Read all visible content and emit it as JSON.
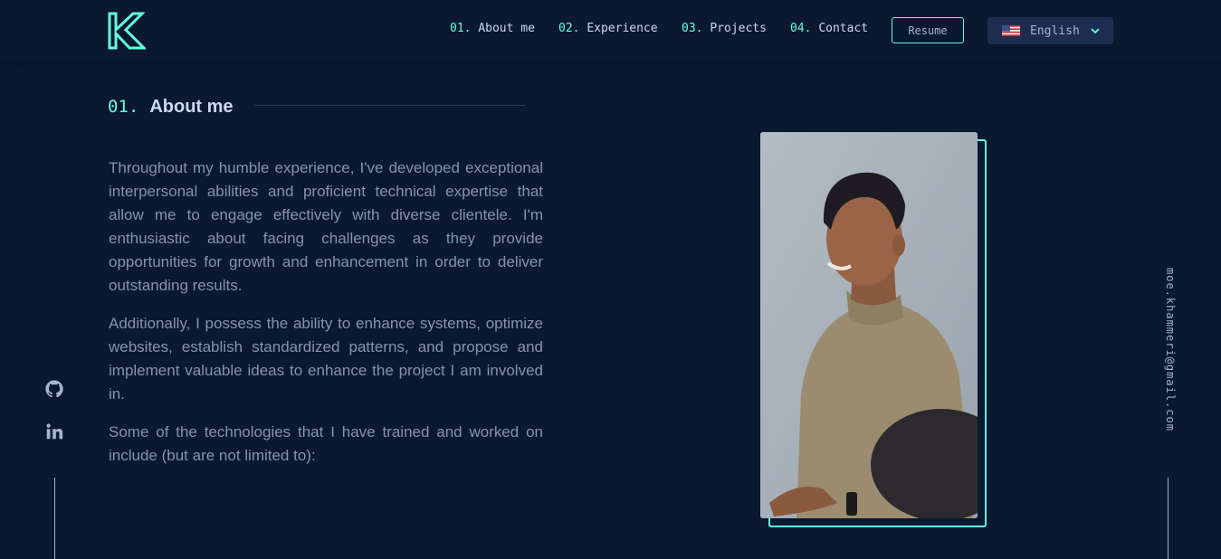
{
  "header": {
    "logo_icon": "k-logo-icon",
    "nav": [
      {
        "num": "01.",
        "label": "About me"
      },
      {
        "num": "02.",
        "label": "Experience"
      },
      {
        "num": "03.",
        "label": "Projects"
      },
      {
        "num": "04.",
        "label": "Contact"
      }
    ],
    "resume_label": "Resume",
    "language": {
      "flag_icon": "us-flag-icon",
      "selected": "English",
      "chevron_icon": "chevron-down-icon"
    }
  },
  "about": {
    "section_number": "01.",
    "section_title": "About me",
    "paragraphs": [
      "Throughout my humble experience, I've developed exceptional interpersonal abilities and proficient technical expertise that allow me to engage effectively with diverse clientele. I'm enthusiastic about facing challenges as they provide opportunities for growth and enhancement in order to deliver outstanding results.",
      "Additionally, I possess the ability to enhance systems, optimize websites, establish standardized patterns, and propose and implement valuable ideas to enhance the project I am involved in.",
      "Some of the technologies that I have trained and worked on include (but are not limited to):"
    ],
    "photo_icon": "profile-photo"
  },
  "social": {
    "github_icon": "github-icon",
    "linkedin_icon": "linkedin-icon"
  },
  "email": "moe.khammeri@gmail.com",
  "colors": {
    "background": "#0b1830",
    "accent": "#64ffda",
    "heading": "#ccd6f6",
    "body_text": "#8892b0"
  }
}
